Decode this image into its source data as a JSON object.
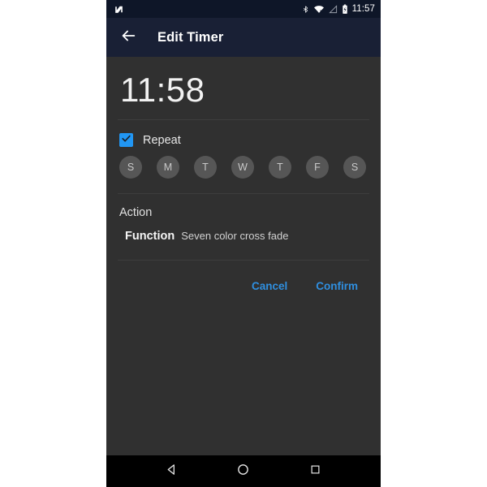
{
  "status_bar": {
    "notification_icon": "android-n-icon",
    "icons": [
      "bluetooth-icon",
      "wifi-off-icon",
      "signal-off-icon",
      "battery-charging-icon"
    ],
    "time": "11:57"
  },
  "app_bar": {
    "back_icon": "arrow-left-icon",
    "title": "Edit Timer"
  },
  "timer": {
    "time_value": "11:58"
  },
  "repeat": {
    "label": "Repeat",
    "checked": true,
    "checkbox_color": "#2196F3",
    "days": [
      {
        "label": "S",
        "name": "sunday",
        "selected": false
      },
      {
        "label": "M",
        "name": "monday",
        "selected": false
      },
      {
        "label": "T",
        "name": "tuesday",
        "selected": false
      },
      {
        "label": "W",
        "name": "wednesday",
        "selected": false
      },
      {
        "label": "T",
        "name": "thursday",
        "selected": false
      },
      {
        "label": "F",
        "name": "friday",
        "selected": false
      },
      {
        "label": "S",
        "name": "saturday",
        "selected": false
      }
    ]
  },
  "action_section": {
    "label": "Action",
    "function_key": "Function",
    "function_value": "Seven color cross fade"
  },
  "footer_buttons": {
    "cancel": "Cancel",
    "confirm": "Confirm",
    "accent_color": "#2F8FE0"
  },
  "nav_bar": {
    "back": "nav-back-icon",
    "home": "nav-home-icon",
    "recents": "nav-recents-icon"
  }
}
